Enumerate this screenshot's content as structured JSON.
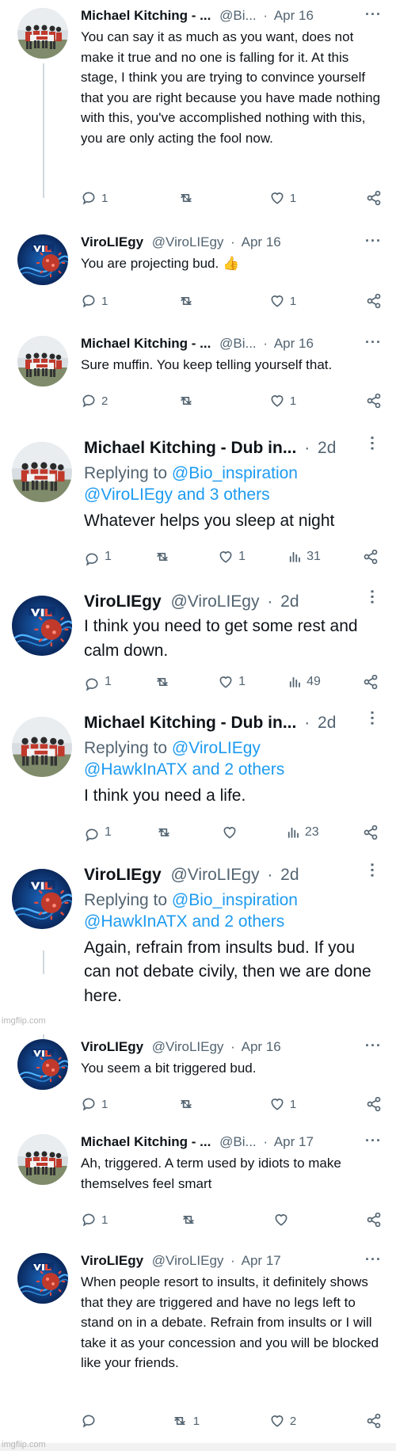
{
  "colors": {
    "text": "#0f1419",
    "muted": "#536471",
    "link": "#1d9bf0",
    "line": "#cfd9de"
  },
  "icons": {
    "reply": "reply-icon",
    "retweet": "retweet-icon",
    "like": "heart-icon",
    "views": "views-icon",
    "share": "share-icon",
    "more": "more-icon"
  },
  "watermarks": {
    "middle": "imgflip.com",
    "bottom": "imgflip.com"
  },
  "tweets": [
    {
      "name": "Michael Kitching - ...",
      "handle": "@Bi...",
      "sep": "·",
      "time": "Apr 16",
      "text": "You can say it as much as you want, does not make it true and no one is falling for it. At this stage, I think you are trying to convince yourself that you are right because you have made nothing with this, you've accomplished nothing with this, you are only acting the fool now.",
      "replies": "1",
      "retweets": "",
      "likes": "1"
    },
    {
      "name": "ViroLIEgy",
      "handle": "@ViroLIEgy",
      "sep": "·",
      "time": "Apr 16",
      "text": "You are projecting bud. 👍",
      "replies": "1",
      "retweets": "",
      "likes": "1"
    },
    {
      "name": "Michael Kitching - ...",
      "handle": "@Bi...",
      "sep": "·",
      "time": "Apr 16",
      "text": "Sure muffin. You keep telling yourself that.",
      "replies": "2",
      "retweets": "",
      "likes": "1"
    },
    {
      "name": "Michael Kitching - Dub in...",
      "sep": "·",
      "time": "2d",
      "reply_prefix": "Replying to",
      "reply_to": "@Bio_inspiration",
      "reply_to2": "@ViroLIEgy and 3 others",
      "text": "Whatever helps you sleep at night",
      "replies": "1",
      "retweets": "",
      "likes": "1",
      "views": "31"
    },
    {
      "name": "ViroLIEgy",
      "handle": "@ViroLIEgy",
      "sep": "·",
      "time": "2d",
      "text": "I think you need to get some rest and calm down.",
      "replies": "1",
      "retweets": "",
      "likes": "1",
      "views": "49"
    },
    {
      "name": "Michael Kitching - Dub in...",
      "sep": "·",
      "time": "2d",
      "reply_prefix": "Replying to",
      "reply_to": "@ViroLIEgy",
      "reply_to2": "@HawkInATX and 2 others",
      "text": "I think you need a life.",
      "replies": "1",
      "retweets": "",
      "likes": "",
      "views": "23"
    },
    {
      "name": "ViroLIEgy",
      "handle": "@ViroLIEgy",
      "sep": "·",
      "time": "2d",
      "reply_prefix": "Replying to",
      "reply_to": "@Bio_inspiration",
      "reply_to2": "@HawkInATX and 2 others",
      "text": "Again, refrain from insults bud. If you can not debate civily, then we are done here."
    },
    {
      "name": "ViroLIEgy",
      "handle": "@ViroLIEgy",
      "sep": "·",
      "time": "Apr 16",
      "text": "You seem a bit triggered bud.",
      "replies": "1",
      "retweets": "",
      "likes": "1"
    },
    {
      "name": "Michael Kitching - ...",
      "handle": "@Bi...",
      "sep": "·",
      "time": "Apr 17",
      "text": "Ah, triggered. A term used by idiots to make themselves feel smart",
      "replies": "1",
      "retweets": "",
      "likes": ""
    },
    {
      "name": "ViroLIEgy",
      "handle": "@ViroLIEgy",
      "sep": "·",
      "time": "Apr 17",
      "text": "When people resort to insults, it definitely shows that they are triggered and have no legs left to stand on in a debate. Refrain from insults or I will take it as your concession and you will be blocked like your friends.",
      "replies": "",
      "retweets": "1",
      "likes": "2"
    }
  ]
}
